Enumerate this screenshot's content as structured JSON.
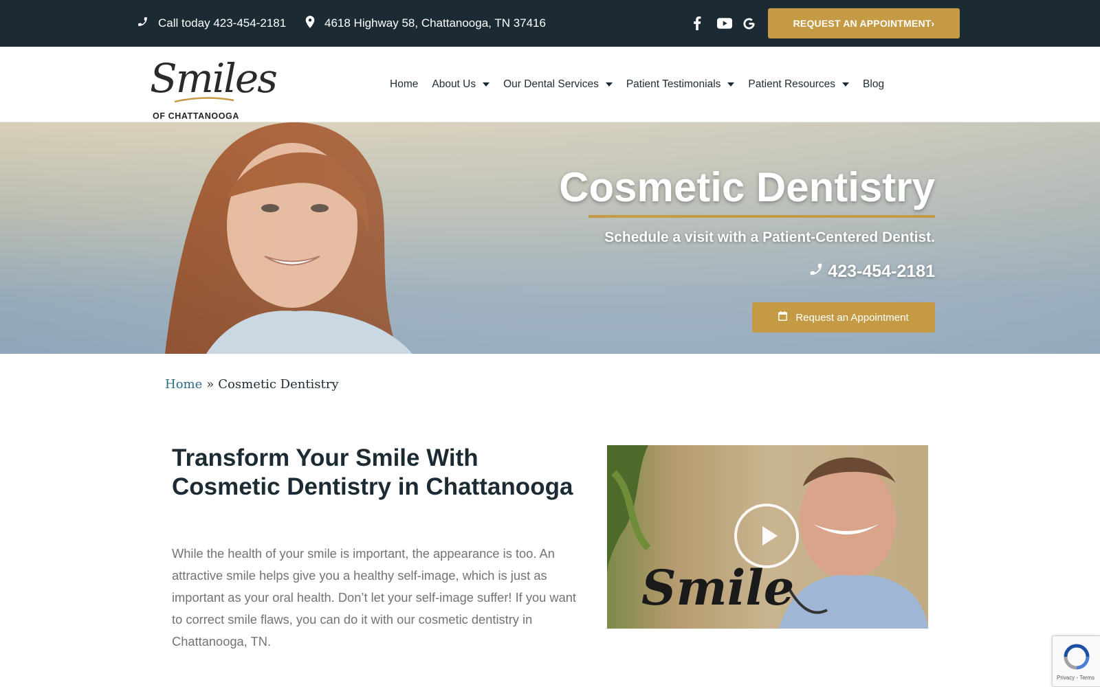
{
  "topbar": {
    "phone_text": "Call today 423-454-2181",
    "address": "4618 Highway 58, Chattanooga, TN 37416",
    "social_icons": [
      "facebook-icon",
      "youtube-icon",
      "google-icon"
    ],
    "appointment_label": "REQUEST AN APPOINTMENT›"
  },
  "logo": {
    "script": "Smiles",
    "subtitle": "OF CHATTANOOGA"
  },
  "nav": {
    "items": [
      {
        "label": "Home",
        "dropdown": false
      },
      {
        "label": "About Us",
        "dropdown": true
      },
      {
        "label": "Our Dental Services",
        "dropdown": true
      },
      {
        "label": "Patient Testimonials",
        "dropdown": true
      },
      {
        "label": "Patient Resources",
        "dropdown": true
      },
      {
        "label": "Blog",
        "dropdown": false
      }
    ]
  },
  "hero": {
    "title": "Cosmetic Dentistry",
    "subtitle": "Schedule a visit with a Patient-Centered Dentist.",
    "phone": "423-454-2181",
    "cta_label": "Request an Appointment"
  },
  "breadcrumb": {
    "home": "Home",
    "separator": "»",
    "current": "Cosmetic Dentistry"
  },
  "main": {
    "heading": "Transform Your Smile With Cosmetic Dentistry in Chattanooga",
    "paragraph": "While the health of your smile is important, the appearance is too. An attractive smile helps give you a healthy self-image, which is just as important as your oral health. Don’t let your self-image suffer! If you want to correct smile flaws, you can do it with our cosmetic dentistry in Chattanooga, TN.",
    "video": {
      "sign_text": "Smile"
    }
  },
  "recaptcha": {
    "terms": "Privacy - Terms"
  },
  "colors": {
    "dark": "#1c2b33",
    "gold": "#c49a45",
    "link": "#2b6c84",
    "body_text": "#737373"
  }
}
